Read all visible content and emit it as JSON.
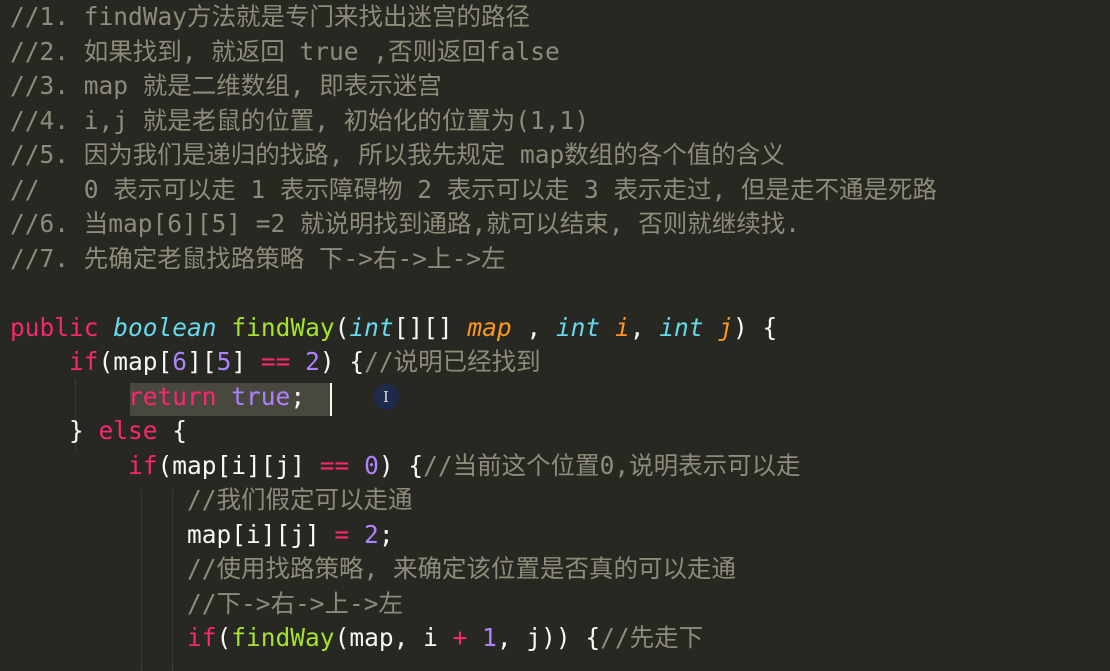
{
  "editor": {
    "lines": [
      [
        {
          "t": "//1. findWay方法就是专门来找出迷宫的路径",
          "c": "comment"
        }
      ],
      [
        {
          "t": "//2. 如果找到, 就返回 true ,否则返回false",
          "c": "comment"
        }
      ],
      [
        {
          "t": "//3. map 就是二维数组, 即表示迷宫",
          "c": "comment"
        }
      ],
      [
        {
          "t": "//4. i,j 就是老鼠的位置, 初始化的位置为(1,1)",
          "c": "comment"
        }
      ],
      [
        {
          "t": "//5. 因为我们是递归的找路, 所以我先规定 map数组的各个值的含义",
          "c": "comment"
        }
      ],
      [
        {
          "t": "//   0 表示可以走 1 表示障碍物 2 表示可以走 3 表示走过, 但是走不通是死路",
          "c": "comment"
        }
      ],
      [
        {
          "t": "//6. 当map[6][5] =2 就说明找到通路,就可以结束, 否则就继续找.",
          "c": "comment"
        }
      ],
      [
        {
          "t": "//7. 先确定老鼠找路策略 下->右->上->左",
          "c": "comment"
        }
      ],
      [],
      [
        {
          "t": "public",
          "c": "keyword"
        },
        {
          "t": " ",
          "c": "plain"
        },
        {
          "t": "boolean",
          "c": "type"
        },
        {
          "t": " ",
          "c": "plain"
        },
        {
          "t": "findWay",
          "c": "func"
        },
        {
          "t": "(",
          "c": "plain"
        },
        {
          "t": "int",
          "c": "type"
        },
        {
          "t": "[][] ",
          "c": "plain"
        },
        {
          "t": "map",
          "c": "param"
        },
        {
          "t": " , ",
          "c": "plain"
        },
        {
          "t": "int",
          "c": "type"
        },
        {
          "t": " ",
          "c": "plain"
        },
        {
          "t": "i",
          "c": "param"
        },
        {
          "t": ", ",
          "c": "plain"
        },
        {
          "t": "int",
          "c": "type"
        },
        {
          "t": " ",
          "c": "plain"
        },
        {
          "t": "j",
          "c": "param"
        },
        {
          "t": ") {",
          "c": "plain"
        }
      ],
      [
        {
          "t": "    ",
          "c": "plain"
        },
        {
          "t": "if",
          "c": "keyword"
        },
        {
          "t": "(map[",
          "c": "plain"
        },
        {
          "t": "6",
          "c": "number"
        },
        {
          "t": "][",
          "c": "plain"
        },
        {
          "t": "5",
          "c": "number"
        },
        {
          "t": "] ",
          "c": "plain"
        },
        {
          "t": "==",
          "c": "operator"
        },
        {
          "t": " ",
          "c": "plain"
        },
        {
          "t": "2",
          "c": "number"
        },
        {
          "t": ") {",
          "c": "plain"
        },
        {
          "t": "//说明已经找到",
          "c": "comment"
        }
      ],
      [
        {
          "t": "        ",
          "c": "plain"
        },
        {
          "t": "return",
          "c": "keyword"
        },
        {
          "t": " ",
          "c": "plain"
        },
        {
          "t": "true",
          "c": "constant"
        },
        {
          "t": ";",
          "c": "plain"
        }
      ],
      [
        {
          "t": "    } ",
          "c": "plain"
        },
        {
          "t": "else",
          "c": "keyword"
        },
        {
          "t": " {",
          "c": "plain"
        }
      ],
      [
        {
          "t": "        ",
          "c": "plain"
        },
        {
          "t": "if",
          "c": "keyword"
        },
        {
          "t": "(map[i][j] ",
          "c": "plain"
        },
        {
          "t": "==",
          "c": "operator"
        },
        {
          "t": " ",
          "c": "plain"
        },
        {
          "t": "0",
          "c": "number"
        },
        {
          "t": ") {",
          "c": "plain"
        },
        {
          "t": "//当前这个位置0,说明表示可以走",
          "c": "comment"
        }
      ],
      [
        {
          "t": "            ",
          "c": "plain"
        },
        {
          "t": "//我们假定可以走通",
          "c": "comment"
        }
      ],
      [
        {
          "t": "            map[i][j] ",
          "c": "plain"
        },
        {
          "t": "=",
          "c": "operator"
        },
        {
          "t": " ",
          "c": "plain"
        },
        {
          "t": "2",
          "c": "number"
        },
        {
          "t": ";",
          "c": "plain"
        }
      ],
      [
        {
          "t": "            ",
          "c": "plain"
        },
        {
          "t": "//使用找路策略, 来确定该位置是否真的可以走通",
          "c": "comment"
        }
      ],
      [
        {
          "t": "            ",
          "c": "plain"
        },
        {
          "t": "//下->右->上->左",
          "c": "comment"
        }
      ],
      [
        {
          "t": "            ",
          "c": "plain"
        },
        {
          "t": "if",
          "c": "keyword"
        },
        {
          "t": "(",
          "c": "plain"
        },
        {
          "t": "findWay",
          "c": "func"
        },
        {
          "t": "(map, i ",
          "c": "plain"
        },
        {
          "t": "+",
          "c": "operator"
        },
        {
          "t": " ",
          "c": "plain"
        },
        {
          "t": "1",
          "c": "number"
        },
        {
          "t": ", j)) {",
          "c": "plain"
        },
        {
          "t": "//先走下",
          "c": "comment"
        }
      ]
    ]
  },
  "colors": {
    "background": "#272822",
    "comment": "#8f8b7b",
    "keyword": "#f92672",
    "type": "#66d9ef",
    "function": "#a6e22e",
    "parameter": "#fd971f",
    "number": "#ae81ff",
    "plain": "#f8f8f2",
    "selection": "#49483e"
  },
  "cursor": {
    "icon": "text-cursor-icon"
  }
}
